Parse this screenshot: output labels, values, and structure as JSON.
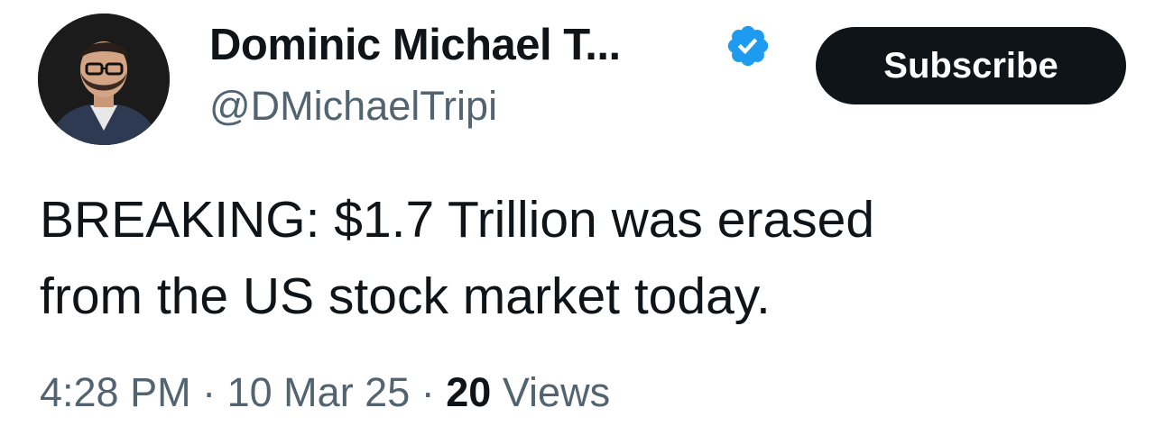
{
  "author": {
    "display_name": "Dominic Michael T...",
    "handle": "@DMichaelTripi",
    "verified": true,
    "verified_color": "#1d9bf0"
  },
  "actions": {
    "subscribe_label": "Subscribe"
  },
  "tweet": {
    "text": "BREAKING: $1.7 Trillion was erased\nfrom the US stock market today.",
    "time": "4:28 PM",
    "separator": "·",
    "date": "10 Mar 25",
    "views_count": "20",
    "views_label": "Views"
  },
  "colors": {
    "text_primary": "#0f1419",
    "text_secondary": "#536471",
    "button_bg": "#0f1419",
    "button_text": "#ffffff"
  }
}
